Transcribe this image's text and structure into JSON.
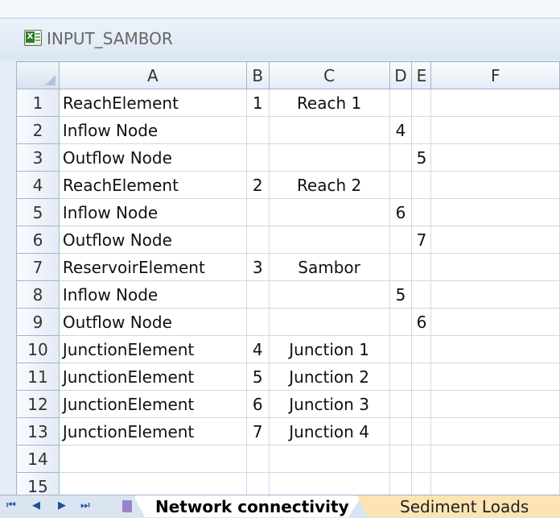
{
  "window": {
    "title": "INPUT_SAMBOR",
    "icon": "excel-workbook-icon"
  },
  "columns": [
    "A",
    "B",
    "C",
    "D",
    "E",
    "F"
  ],
  "rows": [
    {
      "num": "1",
      "A": "ReachElement",
      "B": "1",
      "C": "Reach 1",
      "D": "",
      "E": "",
      "F": ""
    },
    {
      "num": "2",
      "A": "Inflow Node",
      "B": "",
      "C": "",
      "D": "4",
      "E": "",
      "F": ""
    },
    {
      "num": "3",
      "A": "Outflow Node",
      "B": "",
      "C": "",
      "D": "",
      "E": "5",
      "F": ""
    },
    {
      "num": "4",
      "A": "ReachElement",
      "B": "2",
      "C": "Reach 2",
      "D": "",
      "E": "",
      "F": ""
    },
    {
      "num": "5",
      "A": "Inflow Node",
      "B": "",
      "C": "",
      "D": "6",
      "E": "",
      "F": ""
    },
    {
      "num": "6",
      "A": "Outflow Node",
      "B": "",
      "C": "",
      "D": "",
      "E": "7",
      "F": ""
    },
    {
      "num": "7",
      "A": "ReservoirElement",
      "B": "3",
      "C": "Sambor",
      "D": "",
      "E": "",
      "F": ""
    },
    {
      "num": "8",
      "A": "Inflow Node",
      "B": "",
      "C": "",
      "D": "5",
      "E": "",
      "F": ""
    },
    {
      "num": "9",
      "A": "Outflow Node",
      "B": "",
      "C": "",
      "D": "",
      "E": "6",
      "F": ""
    },
    {
      "num": "10",
      "A": "JunctionElement",
      "B": "4",
      "C": "Junction 1",
      "D": "",
      "E": "",
      "F": ""
    },
    {
      "num": "11",
      "A": "JunctionElement",
      "B": "5",
      "C": "Junction 2",
      "D": "",
      "E": "",
      "F": ""
    },
    {
      "num": "12",
      "A": "JunctionElement",
      "B": "6",
      "C": "Junction 3",
      "D": "",
      "E": "",
      "F": ""
    },
    {
      "num": "13",
      "A": "JunctionElement",
      "B": "7",
      "C": "Junction 4",
      "D": "",
      "E": "",
      "F": ""
    },
    {
      "num": "14",
      "A": "",
      "B": "",
      "C": "",
      "D": "",
      "E": "",
      "F": ""
    },
    {
      "num": "15",
      "A": "",
      "B": "",
      "C": "",
      "D": "",
      "E": "",
      "F": ""
    }
  ],
  "sheet_tabs": [
    {
      "label": "Network connectivity",
      "active": true
    },
    {
      "label": "Sediment Loads",
      "active": false
    }
  ],
  "nav_buttons": [
    "first-sheet-icon",
    "prev-sheet-icon",
    "next-sheet-icon",
    "last-sheet-icon"
  ]
}
